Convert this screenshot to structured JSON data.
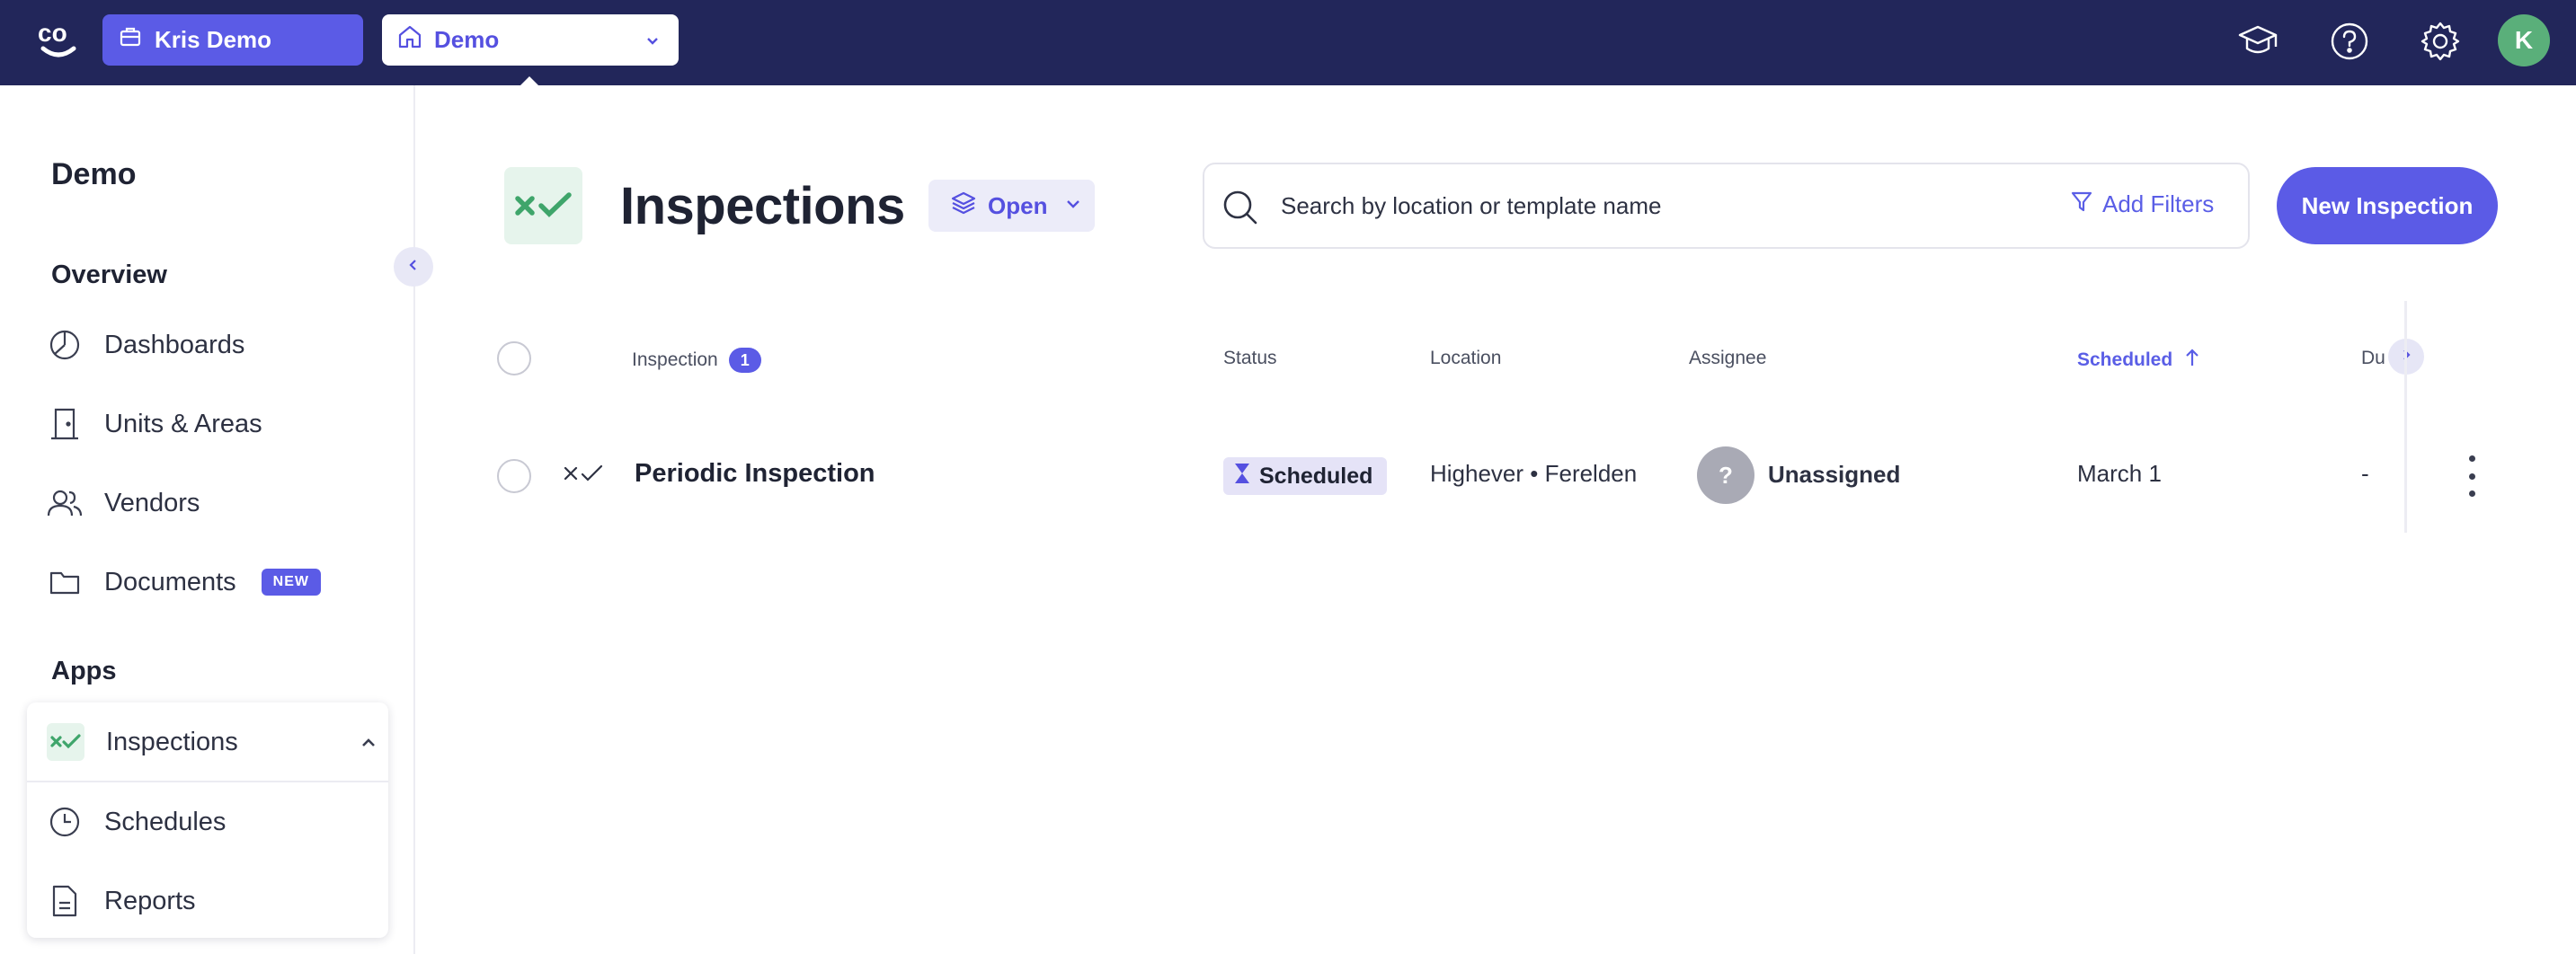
{
  "topbar": {
    "logo_text": "co",
    "org_label": "Kris Demo",
    "property_label": "Demo",
    "avatar_initial": "K",
    "icons": [
      "graduation-cap-icon",
      "help-icon",
      "gear-icon"
    ]
  },
  "sidebar": {
    "title": "Demo",
    "overview_label": "Overview",
    "items": [
      {
        "label": "Dashboards",
        "icon": "pie-chart-icon"
      },
      {
        "label": "Units & Areas",
        "icon": "door-icon"
      },
      {
        "label": "Vendors",
        "icon": "users-icon"
      },
      {
        "label": "Documents",
        "icon": "folder-icon",
        "badge": "NEW"
      }
    ],
    "apps_label": "Apps",
    "apps": [
      {
        "label": "Inspections",
        "icon": "inspections-icon",
        "expanded": true
      },
      {
        "label": "Schedules",
        "icon": "clock-icon"
      },
      {
        "label": "Reports",
        "icon": "document-icon"
      }
    ]
  },
  "header": {
    "title": "Inspections",
    "view_label": "Open",
    "search_placeholder": "Search by location or template name",
    "add_filters_label": "Add Filters",
    "new_button_label": "New Inspection"
  },
  "table": {
    "columns": {
      "inspection": "Inspection",
      "inspection_count": "1",
      "status": "Status",
      "location": "Location",
      "assignee": "Assignee",
      "scheduled": "Scheduled",
      "due": "Du"
    },
    "sort": {
      "column": "Scheduled",
      "direction": "ascending"
    },
    "rows": [
      {
        "name": "Periodic Inspection",
        "status": "Scheduled",
        "location": "Highever • Ferelden",
        "assignee_initial": "?",
        "assignee": "Unassigned",
        "scheduled": "March 1",
        "due": "-"
      }
    ]
  },
  "colors": {
    "topbar_bg": "#22265a",
    "accent": "#5b5be6",
    "success_green": "#3fa56b",
    "avatar_green": "#5aaf7a"
  }
}
